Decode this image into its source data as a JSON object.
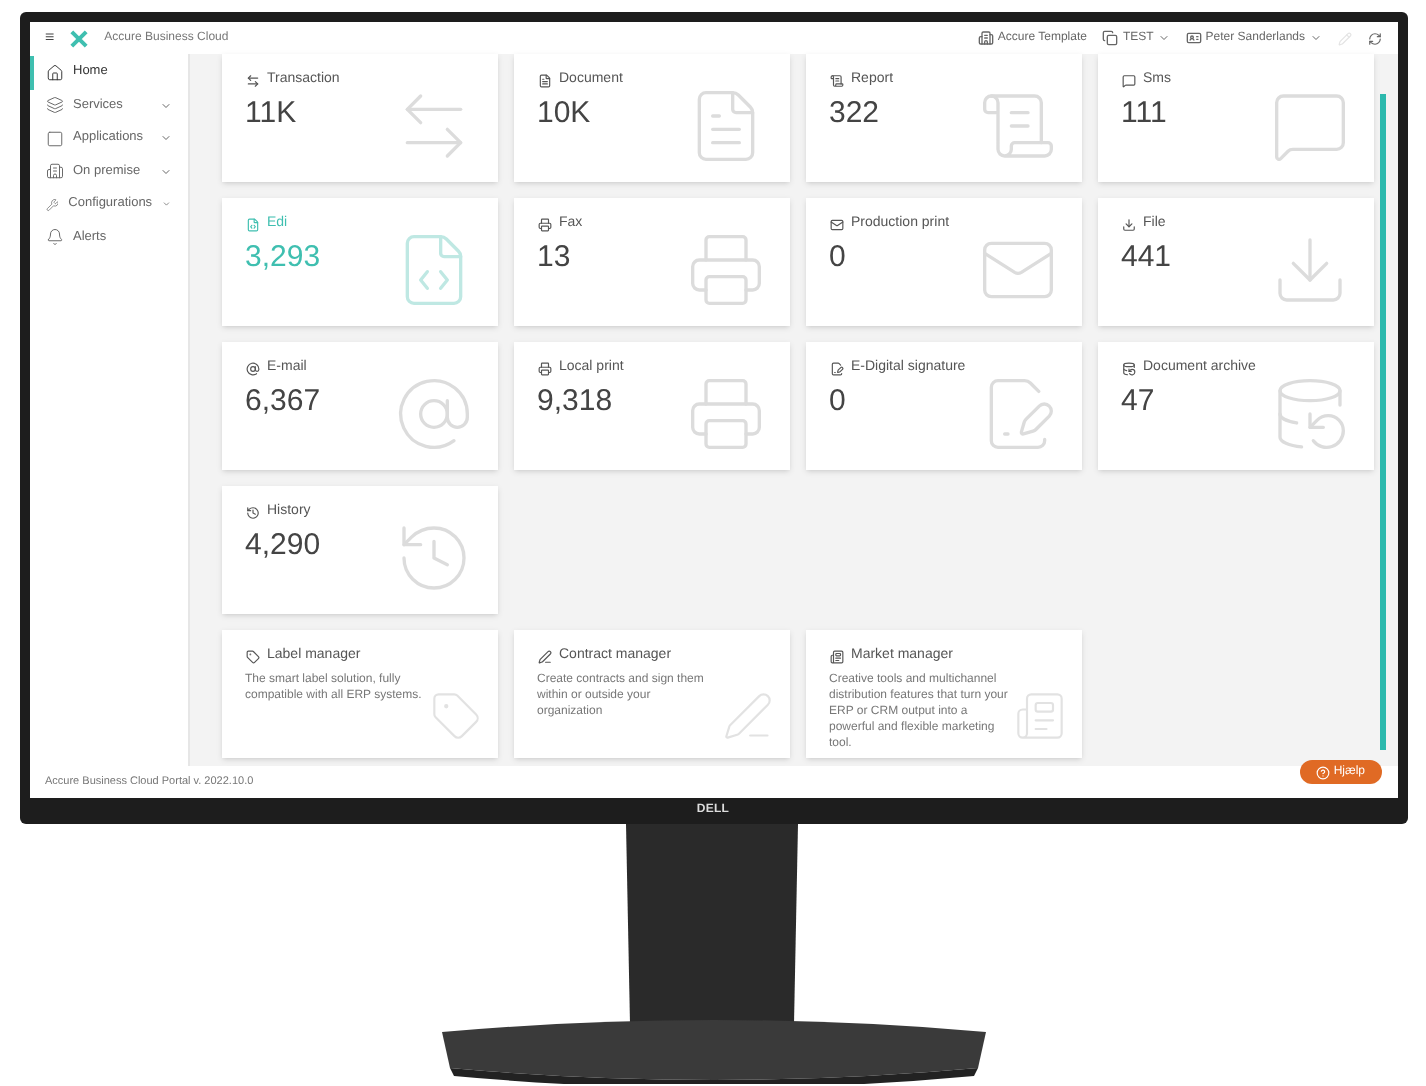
{
  "header": {
    "brand": "Accure Business Cloud",
    "menu_icon": "≡",
    "items": [
      {
        "label": "Accure Template",
        "dropdown": false
      },
      {
        "label": "TEST",
        "dropdown": true
      },
      {
        "label": "Peter Sanderlands",
        "dropdown": true
      }
    ]
  },
  "sidebar": {
    "items": [
      {
        "label": "Home",
        "selected": true,
        "expandable": false
      },
      {
        "label": "Services",
        "selected": false,
        "expandable": true
      },
      {
        "label": "Applications",
        "selected": false,
        "expandable": true
      },
      {
        "label": "On premise",
        "selected": false,
        "expandable": true
      },
      {
        "label": "Configurations",
        "selected": false,
        "expandable": true
      },
      {
        "label": "Alerts",
        "selected": false,
        "expandable": false
      }
    ]
  },
  "tile_rows": [
    [
      {
        "kind": "stat",
        "label": "Transaction",
        "value": "11K",
        "highlighted": false
      },
      {
        "kind": "stat",
        "label": "Document",
        "value": "10K",
        "highlighted": false
      },
      {
        "kind": "stat",
        "label": "Report",
        "value": "322",
        "highlighted": false
      },
      {
        "kind": "stat",
        "label": "Sms",
        "value": "111",
        "highlighted": false
      }
    ],
    [
      {
        "kind": "stat",
        "label": "Edi",
        "value": "3,293",
        "highlighted": true
      },
      {
        "kind": "stat",
        "label": "Fax",
        "value": "13",
        "highlighted": false
      },
      {
        "kind": "stat",
        "label": "Production print",
        "value": "0",
        "highlighted": false
      },
      {
        "kind": "stat",
        "label": "File",
        "value": "441",
        "highlighted": false
      }
    ],
    [
      {
        "kind": "stat",
        "label": "E-mail",
        "value": "6,367",
        "highlighted": false
      },
      {
        "kind": "stat",
        "label": "Local print",
        "value": "9,318",
        "highlighted": false
      },
      {
        "kind": "stat",
        "label": "E-Digital signature",
        "value": "0",
        "highlighted": false
      },
      {
        "kind": "stat",
        "label": "Document archive",
        "value": "47",
        "highlighted": false
      }
    ],
    [
      {
        "kind": "stat",
        "label": "History",
        "value": "4,290",
        "highlighted": false
      }
    ],
    [
      {
        "kind": "app",
        "label": "Label manager",
        "description": "The smart label solution, fully compatible with all ERP systems."
      },
      {
        "kind": "app",
        "label": "Contract manager",
        "description": "Create contracts and sign them within or outside your organization"
      },
      {
        "kind": "app",
        "label": "Market manager",
        "description": "Creative tools and multichannel distribution features that turn your ERP or CRM output into a powerful and flexible marketing tool."
      }
    ]
  ],
  "footer": {
    "version": "Accure Business Cloud Portal v. 2022.10.0",
    "help_button": "Hjælp"
  },
  "monitor": {
    "brand": "DELL"
  }
}
